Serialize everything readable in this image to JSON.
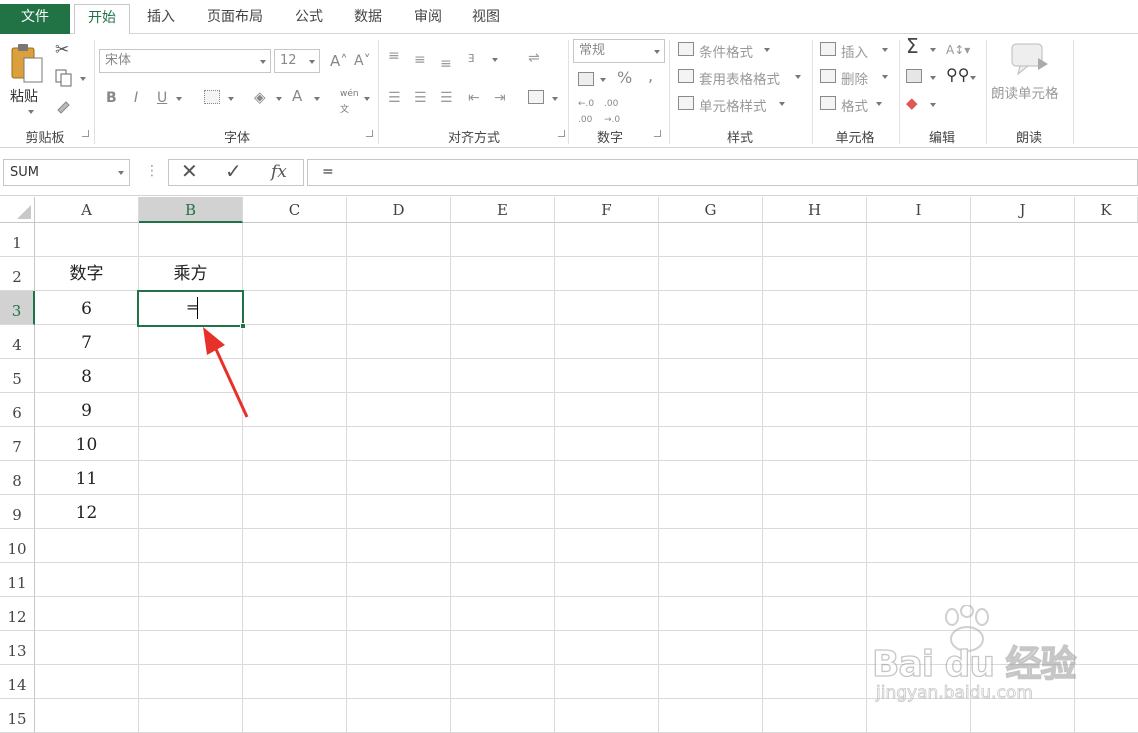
{
  "tabs": [
    {
      "label": "文件"
    },
    {
      "label": "开始"
    },
    {
      "label": "插入"
    },
    {
      "label": "页面布局"
    },
    {
      "label": "公式"
    },
    {
      "label": "数据"
    },
    {
      "label": "审阅"
    },
    {
      "label": "视图"
    }
  ],
  "ribbon": {
    "clipboard": {
      "paste_label": "粘贴",
      "group_label": "剪贴板"
    },
    "font": {
      "font_name": "宋体",
      "font_size": "12",
      "group_label": "字体"
    },
    "alignment": {
      "group_label": "对齐方式"
    },
    "number": {
      "format": "常规",
      "group_label": "数字"
    },
    "styles": {
      "conditional": "条件格式",
      "table": "套用表格格式",
      "cell_styles": "单元格样式",
      "group_label": "样式"
    },
    "cells": {
      "insert": "插入",
      "delete": "删除",
      "format": "格式",
      "group_label": "单元格"
    },
    "editing": {
      "group_label": "编辑"
    },
    "read": {
      "read_cells": "朗读单元格",
      "group_label": "朗读"
    }
  },
  "formula_bar": {
    "name_box": "SUM",
    "fx": "fx",
    "formula": "="
  },
  "columns": [
    "A",
    "B",
    "C",
    "D",
    "E",
    "F",
    "G",
    "H",
    "I",
    "J",
    "K"
  ],
  "rows": [
    "1",
    "2",
    "3",
    "4",
    "5",
    "6",
    "7",
    "8",
    "9",
    "10",
    "11",
    "12",
    "13",
    "14",
    "15"
  ],
  "cells": {
    "A2": "数字",
    "B2": "乘方",
    "A3": "6",
    "A4": "7",
    "A5": "8",
    "A6": "9",
    "A7": "10",
    "A8": "11",
    "A9": "12",
    "B3": "="
  },
  "watermark": {
    "brand": "Bai du 经验",
    "url": "jingyan.baidu.com"
  },
  "colors": {
    "excel_green": "#217346",
    "annotation_red": "#e8302b"
  }
}
